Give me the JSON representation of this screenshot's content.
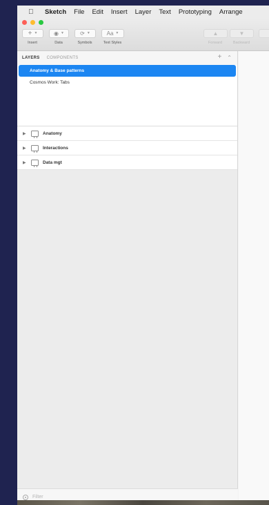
{
  "menubar": {
    "app_name": "Sketch",
    "items": [
      "File",
      "Edit",
      "Insert",
      "Layer",
      "Text",
      "Prototyping",
      "Arrange"
    ]
  },
  "toolbar": {
    "insert_label": "Insert",
    "data_label": "Data",
    "symbols_label": "Symbols",
    "text_styles_label": "Text Styles",
    "text_styles_button": "Aa",
    "forward_label": "Forward",
    "backward_label": "Backward"
  },
  "panel": {
    "tab_layers": "LAYERS",
    "tab_components": "COMPONENTS",
    "pages": [
      {
        "label": "Anatomy & Base patterns",
        "selected": true
      },
      {
        "label": "Cosmos Work: Tabs",
        "selected": false
      }
    ],
    "artboards": [
      {
        "label": "Anatomy"
      },
      {
        "label": "Interactions"
      },
      {
        "label": "Data mgt"
      }
    ],
    "filter_placeholder": "Filter"
  },
  "colors": {
    "selection": "#1c86f2",
    "desktop_bg": "#1f2350"
  }
}
